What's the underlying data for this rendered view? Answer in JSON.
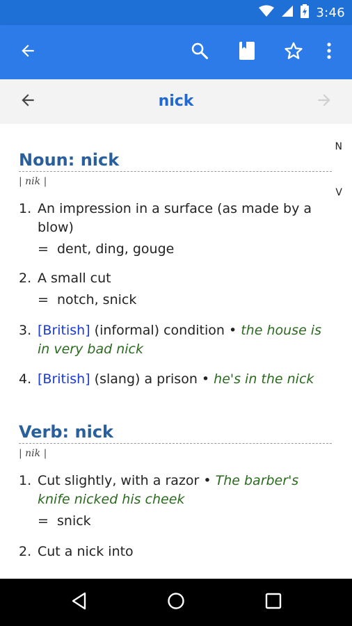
{
  "status_bar": {
    "time": "3:46",
    "icons": [
      "wifi-icon",
      "cell-signal-icon",
      "battery-charging-icon"
    ]
  },
  "app_bar": {
    "icons": [
      "back-arrow-icon",
      "search-icon",
      "bookmark-icon",
      "star-icon",
      "more-vert-icon"
    ],
    "color": "#2d7be8"
  },
  "word_nav": {
    "title": "nick"
  },
  "index_letters": [
    "N",
    "V"
  ],
  "noun": {
    "heading": "Noun: nick",
    "pronunciation": "| nik |",
    "senses": [
      {
        "num": "1.",
        "text": "An impression in a surface (as made by a blow)",
        "synonyms": "dent, ding, gouge"
      },
      {
        "num": "2.",
        "text": "A small cut",
        "synonyms": "notch, snick"
      },
      {
        "num": "3.",
        "tag": "[British]",
        "text": "(informal) condition •",
        "example": "the house is in very bad nick"
      },
      {
        "num": "4.",
        "tag": "[British]",
        "text": "(slang) a prison •",
        "example": "he's in the nick"
      }
    ]
  },
  "verb": {
    "heading": "Verb: nick",
    "pronunciation": "| nik |",
    "senses": [
      {
        "num": "1.",
        "text": "Cut slightly, with a razor •",
        "example": "The barber's knife nicked his cheek",
        "synonyms": "snick"
      },
      {
        "num": "2.",
        "text": "Cut a nick into"
      }
    ]
  },
  "synonym_symbol": "=",
  "nav_bar": {
    "icons": [
      "nav-back-icon",
      "nav-home-icon",
      "nav-recents-icon"
    ]
  }
}
